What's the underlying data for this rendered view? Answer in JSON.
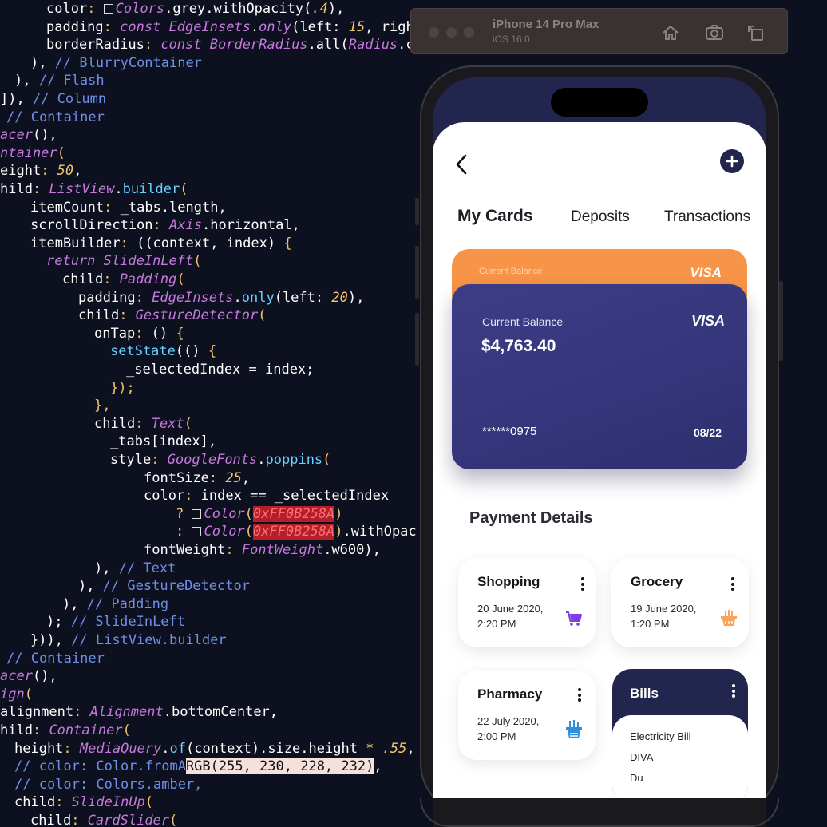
{
  "editor": {
    "lines": [
      {
        "indent": 58,
        "tokens": [
          [
            "prop",
            "color"
          ],
          [
            "punc",
            ": "
          ],
          [
            "swatch",
            ""
          ],
          [
            "type",
            "Colors"
          ],
          [
            "prop",
            ".grey.withOpacity("
          ],
          [
            "num",
            ".4"
          ],
          [
            "prop",
            "),"
          ]
        ]
      },
      {
        "indent": 58,
        "tokens": [
          [
            "prop",
            "padding"
          ],
          [
            "punc",
            ": "
          ],
          [
            "kw",
            "const "
          ],
          [
            "type",
            "EdgeInsets"
          ],
          [
            "prop",
            "."
          ],
          [
            "type",
            "only"
          ],
          [
            "prop",
            "(left: "
          ],
          [
            "num",
            "15"
          ],
          [
            "prop",
            ", righ"
          ]
        ]
      },
      {
        "indent": 58,
        "tokens": [
          [
            "prop",
            "borderRadius"
          ],
          [
            "punc",
            ": "
          ],
          [
            "kw",
            "const "
          ],
          [
            "type",
            "BorderRadius"
          ],
          [
            "prop",
            ".all("
          ],
          [
            "type",
            "Radius"
          ],
          [
            "prop",
            ".c"
          ]
        ]
      },
      {
        "indent": 38,
        "tokens": [
          [
            "prop",
            "), "
          ],
          [
            "comment",
            "// BlurryContainer"
          ]
        ]
      },
      {
        "indent": 18,
        "tokens": [
          [
            "prop",
            "), "
          ],
          [
            "comment",
            "// Flash"
          ]
        ]
      },
      {
        "indent": 0,
        "tokens": [
          [
            "prop",
            "]), "
          ],
          [
            "comment",
            "// Column"
          ]
        ]
      },
      {
        "indent": 8,
        "tokens": [
          [
            "comment",
            "// Container"
          ]
        ]
      },
      {
        "indent": 0,
        "tokens": [
          [
            "type",
            "acer"
          ],
          [
            "prop",
            "(),"
          ]
        ]
      },
      {
        "indent": 0,
        "tokens": [
          [
            "type",
            "ntainer"
          ],
          [
            "punc",
            "("
          ]
        ]
      },
      {
        "indent": 0,
        "tokens": [
          [
            "prop",
            "eight"
          ],
          [
            "punc",
            ": "
          ],
          [
            "num",
            "50"
          ],
          [
            "prop",
            ","
          ]
        ]
      },
      {
        "indent": 0,
        "tokens": [
          [
            "prop",
            "hild"
          ],
          [
            "punc",
            ": "
          ],
          [
            "type",
            "ListView"
          ],
          [
            "prop",
            "."
          ],
          [
            "fn",
            "builder"
          ],
          [
            "punc",
            "("
          ]
        ]
      },
      {
        "indent": 38,
        "tokens": [
          [
            "prop",
            "itemCount"
          ],
          [
            "punc",
            ": "
          ],
          [
            "prop",
            "_tabs.length,"
          ]
        ]
      },
      {
        "indent": 38,
        "tokens": [
          [
            "prop",
            "scrollDirection"
          ],
          [
            "punc",
            ": "
          ],
          [
            "type",
            "Axis"
          ],
          [
            "prop",
            ".horizontal,"
          ]
        ]
      },
      {
        "indent": 38,
        "tokens": [
          [
            "prop",
            "itemBuilder"
          ],
          [
            "punc",
            ": "
          ],
          [
            "prop",
            "((context, index) "
          ],
          [
            "punc",
            "{"
          ]
        ]
      },
      {
        "indent": 58,
        "tokens": [
          [
            "kw",
            "return "
          ],
          [
            "type",
            "SlideInLeft"
          ],
          [
            "punc",
            "("
          ]
        ]
      },
      {
        "indent": 78,
        "tokens": [
          [
            "prop",
            "child"
          ],
          [
            "punc",
            ": "
          ],
          [
            "type",
            "Padding"
          ],
          [
            "punc",
            "("
          ]
        ]
      },
      {
        "indent": 98,
        "tokens": [
          [
            "prop",
            "padding"
          ],
          [
            "punc",
            ": "
          ],
          [
            "type",
            "EdgeInsets"
          ],
          [
            "prop",
            "."
          ],
          [
            "fn",
            "only"
          ],
          [
            "prop",
            "(left: "
          ],
          [
            "num",
            "20"
          ],
          [
            "prop",
            "),"
          ]
        ]
      },
      {
        "indent": 98,
        "tokens": [
          [
            "prop",
            "child"
          ],
          [
            "punc",
            ": "
          ],
          [
            "type",
            "GestureDetector"
          ],
          [
            "punc",
            "("
          ]
        ]
      },
      {
        "indent": 118,
        "tokens": [
          [
            "prop",
            "onTap"
          ],
          [
            "punc",
            ": "
          ],
          [
            "prop",
            "() "
          ],
          [
            "punc",
            "{"
          ]
        ]
      },
      {
        "indent": 138,
        "tokens": [
          [
            "fn",
            "setState"
          ],
          [
            "prop",
            "(() "
          ],
          [
            "punc",
            "{"
          ]
        ]
      },
      {
        "indent": 158,
        "tokens": [
          [
            "prop",
            "_selectedIndex = index;"
          ]
        ]
      },
      {
        "indent": 138,
        "tokens": [
          [
            "punc",
            "});"
          ]
        ]
      },
      {
        "indent": 118,
        "tokens": [
          [
            "punc",
            "},"
          ]
        ]
      },
      {
        "indent": 118,
        "tokens": [
          [
            "prop",
            "child"
          ],
          [
            "punc",
            ": "
          ],
          [
            "type",
            "Text"
          ],
          [
            "punc",
            "("
          ]
        ]
      },
      {
        "indent": 138,
        "tokens": [
          [
            "prop",
            "_tabs[index],"
          ]
        ]
      },
      {
        "indent": 138,
        "tokens": [
          [
            "prop",
            "style"
          ],
          [
            "punc",
            ": "
          ],
          [
            "type",
            "GoogleFonts"
          ],
          [
            "prop",
            "."
          ],
          [
            "fn",
            "poppins"
          ],
          [
            "punc",
            "("
          ]
        ]
      },
      {
        "indent": 180,
        "tokens": [
          [
            "prop",
            "fontSize"
          ],
          [
            "punc",
            ": "
          ],
          [
            "num",
            "25"
          ],
          [
            "prop",
            ","
          ]
        ]
      },
      {
        "indent": 180,
        "tokens": [
          [
            "prop",
            "color"
          ],
          [
            "punc",
            ": "
          ],
          [
            "prop",
            "index == _selectedIndex"
          ]
        ]
      },
      {
        "indent": 220,
        "tokens": [
          [
            "punc",
            "? "
          ],
          [
            "swatch",
            ""
          ],
          [
            "type",
            "Color"
          ],
          [
            "punc",
            "("
          ],
          [
            "hex",
            "0xFF0B258A"
          ],
          [
            "punc",
            ")"
          ]
        ]
      },
      {
        "indent": 220,
        "tokens": [
          [
            "punc",
            ": "
          ],
          [
            "swatch",
            ""
          ],
          [
            "type",
            "Color"
          ],
          [
            "punc",
            "("
          ],
          [
            "hex",
            "0xFF0B258A"
          ],
          [
            "punc",
            ")"
          ],
          [
            "prop",
            ".withOpac"
          ]
        ]
      },
      {
        "indent": 180,
        "tokens": [
          [
            "prop",
            "fontWeight"
          ],
          [
            "punc",
            ": "
          ],
          [
            "type",
            "FontWeight"
          ],
          [
            "prop",
            ".w600),"
          ]
        ]
      },
      {
        "indent": 118,
        "tokens": [
          [
            "prop",
            "), "
          ],
          [
            "comment",
            "// Text"
          ]
        ]
      },
      {
        "indent": 98,
        "tokens": [
          [
            "prop",
            "), "
          ],
          [
            "comment",
            "// GestureDetector"
          ]
        ]
      },
      {
        "indent": 78,
        "tokens": [
          [
            "prop",
            "), "
          ],
          [
            "comment",
            "// Padding"
          ]
        ]
      },
      {
        "indent": 58,
        "tokens": [
          [
            "prop",
            "); "
          ],
          [
            "comment",
            "// SlideInLeft"
          ]
        ]
      },
      {
        "indent": 38,
        "tokens": [
          [
            "prop",
            "})), "
          ],
          [
            "comment",
            "// ListView.builder"
          ]
        ]
      },
      {
        "indent": 8,
        "tokens": [
          [
            "comment",
            "// Container"
          ]
        ]
      },
      {
        "indent": 0,
        "tokens": [
          [
            "type",
            "acer"
          ],
          [
            "prop",
            "(),"
          ]
        ]
      },
      {
        "indent": 0,
        "tokens": [
          [
            "type",
            "ign"
          ],
          [
            "punc",
            "("
          ]
        ]
      },
      {
        "indent": 0,
        "tokens": [
          [
            "prop",
            "alignment"
          ],
          [
            "punc",
            ": "
          ],
          [
            "type",
            "Alignment"
          ],
          [
            "prop",
            ".bottomCenter,"
          ]
        ]
      },
      {
        "indent": 0,
        "tokens": [
          [
            "prop",
            "hild"
          ],
          [
            "punc",
            ": "
          ],
          [
            "type",
            "Container"
          ],
          [
            "punc",
            "("
          ]
        ]
      },
      {
        "indent": 18,
        "tokens": [
          [
            "prop",
            "height"
          ],
          [
            "punc",
            ": "
          ],
          [
            "type",
            "MediaQuery"
          ],
          [
            "prop",
            "."
          ],
          [
            "fn",
            "of"
          ],
          [
            "prop",
            "(context).size.height "
          ],
          [
            "punc",
            "* "
          ],
          [
            "num",
            ".55"
          ],
          [
            "prop",
            ","
          ]
        ]
      },
      {
        "indent": 18,
        "tokens": [
          [
            "comment",
            "// color: Color.fromA"
          ],
          [
            "sel",
            "RGB(255, 230, 228, 232)"
          ],
          [
            "prop",
            ","
          ]
        ]
      },
      {
        "indent": 18,
        "tokens": [
          [
            "comment",
            "// color: Colors.amber,"
          ]
        ]
      },
      {
        "indent": 18,
        "tokens": [
          [
            "prop",
            "child"
          ],
          [
            "punc",
            ": "
          ],
          [
            "type",
            "SlideInUp"
          ],
          [
            "punc",
            "("
          ]
        ]
      },
      {
        "indent": 38,
        "tokens": [
          [
            "prop",
            "child"
          ],
          [
            "punc",
            ": "
          ],
          [
            "type",
            "CardSlider"
          ],
          [
            "punc",
            "("
          ]
        ]
      }
    ]
  },
  "simulator": {
    "title": "iPhone 14 Pro Max",
    "subtitle": "iOS 16.0",
    "icons": [
      "home-icon",
      "screenshot-icon",
      "rotate-icon"
    ]
  },
  "app": {
    "back_icon": "chevron-left-icon",
    "add_icon": "plus-icon",
    "tabs": [
      "My Cards",
      "Deposits",
      "Transactions"
    ],
    "back_card": {
      "label": "Current Balance",
      "brand": "VISA",
      "color": "#f79447"
    },
    "front_card": {
      "label": "Current Balance",
      "balance": "$4,763.40",
      "brand": "VISA",
      "number": "******0975",
      "expiry": "08/22",
      "color": "#3b3b80"
    },
    "payment_heading": "Payment Details",
    "payments": [
      {
        "title": "Shopping",
        "date": "20 June 2020,",
        "time": "2:20 PM",
        "icon": "cart-icon",
        "icon_color": "#7b3fe4"
      },
      {
        "title": "Grocery",
        "date": "19 June 2020,",
        "time": "1:20 PM",
        "icon": "basket-icon",
        "icon_color": "#f7a35c"
      },
      {
        "title": "Pharmacy",
        "date": "22 July 2020,",
        "time": "2:00 PM",
        "icon": "medicine-icon",
        "icon_color": "#2f8fd8"
      }
    ],
    "bills": {
      "title": "Bills",
      "items": [
        "Electricity Bill",
        "DIVA",
        "Du"
      ],
      "color": "#22264f"
    }
  }
}
